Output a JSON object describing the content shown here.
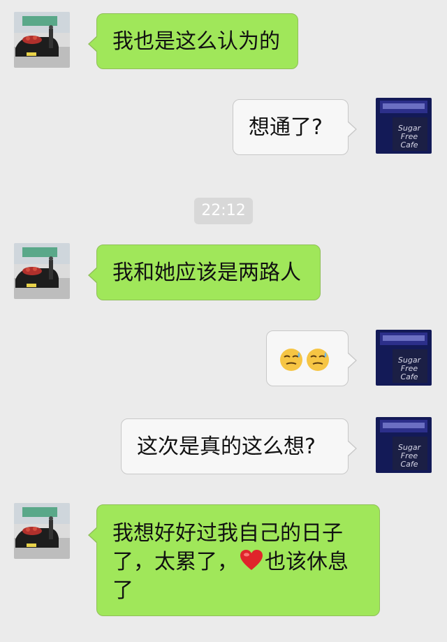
{
  "timestamp": "22:12",
  "messages": [
    {
      "id": 1,
      "side": "in",
      "text": "我也是这么认为的"
    },
    {
      "id": 2,
      "side": "out",
      "text": "想通了?"
    },
    {
      "id": 3,
      "side": "in",
      "text": "我和她应该是两路人"
    },
    {
      "id": 4,
      "side": "out",
      "emoji": [
        "smirk-sweat-emoji",
        "smirk-sweat-emoji"
      ]
    },
    {
      "id": 5,
      "side": "out",
      "text": "这次是真的这么想?"
    },
    {
      "id": 6,
      "side": "in",
      "text_parts": [
        "我想好好过我自己的日子了，太累了，",
        "也该休息了"
      ],
      "inline_icon": "heart-emoji"
    }
  ],
  "avatars": {
    "contact": "car-photo-avatar",
    "self": "sugar-free-cafe-avatar",
    "self_sign_text": [
      "Sugar",
      "Free",
      "Cafe"
    ]
  },
  "colors": {
    "background": "#ebebeb",
    "incoming_bubble": "#a0e75a",
    "outgoing_bubble": "#f7f7f7",
    "timestamp_bg": "#d8d8d8"
  }
}
